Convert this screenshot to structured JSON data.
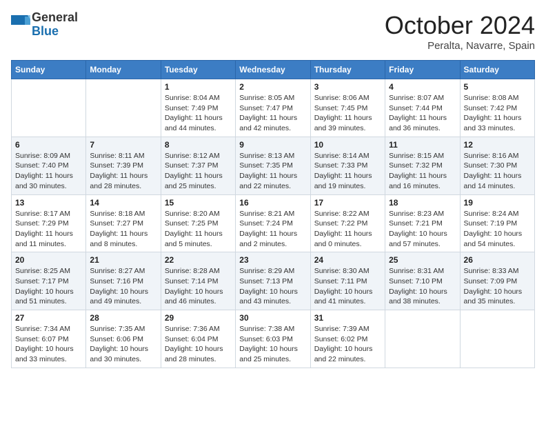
{
  "header": {
    "logo_general": "General",
    "logo_blue": "Blue",
    "month_title": "October 2024",
    "location": "Peralta, Navarre, Spain"
  },
  "weekdays": [
    "Sunday",
    "Monday",
    "Tuesday",
    "Wednesday",
    "Thursday",
    "Friday",
    "Saturday"
  ],
  "weeks": [
    [
      null,
      null,
      {
        "day": "1",
        "sunrise": "Sunrise: 8:04 AM",
        "sunset": "Sunset: 7:49 PM",
        "daylight": "Daylight: 11 hours and 44 minutes."
      },
      {
        "day": "2",
        "sunrise": "Sunrise: 8:05 AM",
        "sunset": "Sunset: 7:47 PM",
        "daylight": "Daylight: 11 hours and 42 minutes."
      },
      {
        "day": "3",
        "sunrise": "Sunrise: 8:06 AM",
        "sunset": "Sunset: 7:45 PM",
        "daylight": "Daylight: 11 hours and 39 minutes."
      },
      {
        "day": "4",
        "sunrise": "Sunrise: 8:07 AM",
        "sunset": "Sunset: 7:44 PM",
        "daylight": "Daylight: 11 hours and 36 minutes."
      },
      {
        "day": "5",
        "sunrise": "Sunrise: 8:08 AM",
        "sunset": "Sunset: 7:42 PM",
        "daylight": "Daylight: 11 hours and 33 minutes."
      }
    ],
    [
      {
        "day": "6",
        "sunrise": "Sunrise: 8:09 AM",
        "sunset": "Sunset: 7:40 PM",
        "daylight": "Daylight: 11 hours and 30 minutes."
      },
      {
        "day": "7",
        "sunrise": "Sunrise: 8:11 AM",
        "sunset": "Sunset: 7:39 PM",
        "daylight": "Daylight: 11 hours and 28 minutes."
      },
      {
        "day": "8",
        "sunrise": "Sunrise: 8:12 AM",
        "sunset": "Sunset: 7:37 PM",
        "daylight": "Daylight: 11 hours and 25 minutes."
      },
      {
        "day": "9",
        "sunrise": "Sunrise: 8:13 AM",
        "sunset": "Sunset: 7:35 PM",
        "daylight": "Daylight: 11 hours and 22 minutes."
      },
      {
        "day": "10",
        "sunrise": "Sunrise: 8:14 AM",
        "sunset": "Sunset: 7:33 PM",
        "daylight": "Daylight: 11 hours and 19 minutes."
      },
      {
        "day": "11",
        "sunrise": "Sunrise: 8:15 AM",
        "sunset": "Sunset: 7:32 PM",
        "daylight": "Daylight: 11 hours and 16 minutes."
      },
      {
        "day": "12",
        "sunrise": "Sunrise: 8:16 AM",
        "sunset": "Sunset: 7:30 PM",
        "daylight": "Daylight: 11 hours and 14 minutes."
      }
    ],
    [
      {
        "day": "13",
        "sunrise": "Sunrise: 8:17 AM",
        "sunset": "Sunset: 7:29 PM",
        "daylight": "Daylight: 11 hours and 11 minutes."
      },
      {
        "day": "14",
        "sunrise": "Sunrise: 8:18 AM",
        "sunset": "Sunset: 7:27 PM",
        "daylight": "Daylight: 11 hours and 8 minutes."
      },
      {
        "day": "15",
        "sunrise": "Sunrise: 8:20 AM",
        "sunset": "Sunset: 7:25 PM",
        "daylight": "Daylight: 11 hours and 5 minutes."
      },
      {
        "day": "16",
        "sunrise": "Sunrise: 8:21 AM",
        "sunset": "Sunset: 7:24 PM",
        "daylight": "Daylight: 11 hours and 2 minutes."
      },
      {
        "day": "17",
        "sunrise": "Sunrise: 8:22 AM",
        "sunset": "Sunset: 7:22 PM",
        "daylight": "Daylight: 11 hours and 0 minutes."
      },
      {
        "day": "18",
        "sunrise": "Sunrise: 8:23 AM",
        "sunset": "Sunset: 7:21 PM",
        "daylight": "Daylight: 10 hours and 57 minutes."
      },
      {
        "day": "19",
        "sunrise": "Sunrise: 8:24 AM",
        "sunset": "Sunset: 7:19 PM",
        "daylight": "Daylight: 10 hours and 54 minutes."
      }
    ],
    [
      {
        "day": "20",
        "sunrise": "Sunrise: 8:25 AM",
        "sunset": "Sunset: 7:17 PM",
        "daylight": "Daylight: 10 hours and 51 minutes."
      },
      {
        "day": "21",
        "sunrise": "Sunrise: 8:27 AM",
        "sunset": "Sunset: 7:16 PM",
        "daylight": "Daylight: 10 hours and 49 minutes."
      },
      {
        "day": "22",
        "sunrise": "Sunrise: 8:28 AM",
        "sunset": "Sunset: 7:14 PM",
        "daylight": "Daylight: 10 hours and 46 minutes."
      },
      {
        "day": "23",
        "sunrise": "Sunrise: 8:29 AM",
        "sunset": "Sunset: 7:13 PM",
        "daylight": "Daylight: 10 hours and 43 minutes."
      },
      {
        "day": "24",
        "sunrise": "Sunrise: 8:30 AM",
        "sunset": "Sunset: 7:11 PM",
        "daylight": "Daylight: 10 hours and 41 minutes."
      },
      {
        "day": "25",
        "sunrise": "Sunrise: 8:31 AM",
        "sunset": "Sunset: 7:10 PM",
        "daylight": "Daylight: 10 hours and 38 minutes."
      },
      {
        "day": "26",
        "sunrise": "Sunrise: 8:33 AM",
        "sunset": "Sunset: 7:09 PM",
        "daylight": "Daylight: 10 hours and 35 minutes."
      }
    ],
    [
      {
        "day": "27",
        "sunrise": "Sunrise: 7:34 AM",
        "sunset": "Sunset: 6:07 PM",
        "daylight": "Daylight: 10 hours and 33 minutes."
      },
      {
        "day": "28",
        "sunrise": "Sunrise: 7:35 AM",
        "sunset": "Sunset: 6:06 PM",
        "daylight": "Daylight: 10 hours and 30 minutes."
      },
      {
        "day": "29",
        "sunrise": "Sunrise: 7:36 AM",
        "sunset": "Sunset: 6:04 PM",
        "daylight": "Daylight: 10 hours and 28 minutes."
      },
      {
        "day": "30",
        "sunrise": "Sunrise: 7:38 AM",
        "sunset": "Sunset: 6:03 PM",
        "daylight": "Daylight: 10 hours and 25 minutes."
      },
      {
        "day": "31",
        "sunrise": "Sunrise: 7:39 AM",
        "sunset": "Sunset: 6:02 PM",
        "daylight": "Daylight: 10 hours and 22 minutes."
      },
      null,
      null
    ]
  ]
}
